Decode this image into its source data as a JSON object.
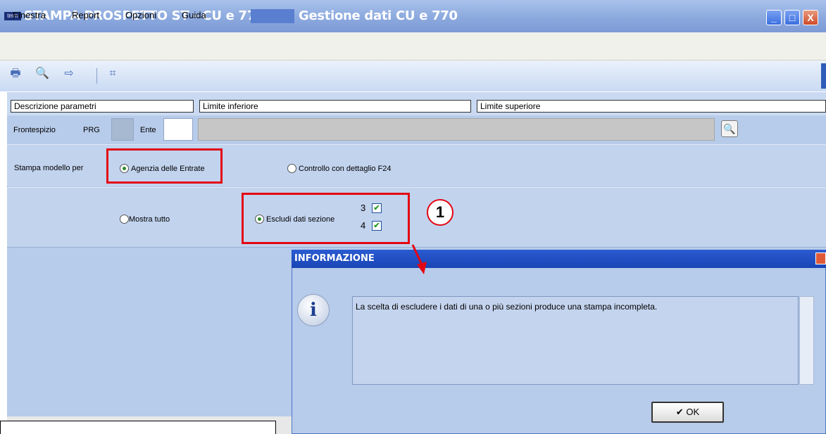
{
  "window": {
    "logo_text": "tmm",
    "title": "STAMPA PROSPETTO ST - CU e 770",
    "title_suffix": "Gestione dati CU e 770",
    "min_label": "_",
    "max_label": "□",
    "close_label": "X"
  },
  "menu": [
    "Finestra",
    "Report",
    "Opzioni",
    "Guida"
  ],
  "toolbar": {
    "icons": [
      "print-icon",
      "print-preview-icon",
      "export-icon",
      "calculator-icon"
    ],
    "glyphs": [
      "🖶",
      "🔍",
      "⇨",
      "⌗"
    ]
  },
  "grid_header": {
    "descrizione": "Descrizione parametri",
    "limite_inferiore": "Limite inferiore",
    "limite_superiore": "Limite superiore"
  },
  "frontespizio": {
    "label": "Frontespizio",
    "prg_label": "PRG",
    "prg_value": "",
    "ente_label": "Ente",
    "ente_value": "",
    "search_glyph": "🔍"
  },
  "stampa_modello": {
    "label": "Stampa modello per",
    "option_agenzia": "Agenzia delle Entrate",
    "option_controllo": "Controllo con dettaglio F24",
    "selected": "agenzia"
  },
  "filtri": {
    "option_mostra": "Mostra tutto",
    "option_escludi": "Escludi dati sezione",
    "selected": "escludi",
    "sezioni": [
      {
        "num": "3",
        "checked": true
      },
      {
        "num": "4",
        "checked": true
      }
    ],
    "check_glyph": "✔"
  },
  "annotation": {
    "number": "1",
    "color": "#e30613"
  },
  "dialog": {
    "title": "INFORMAZIONE",
    "icon_glyph": "i",
    "message": "La scelta di escludere i dati di una o più sezioni produce una stampa incompleta.",
    "ok_label": "✔ OK"
  }
}
